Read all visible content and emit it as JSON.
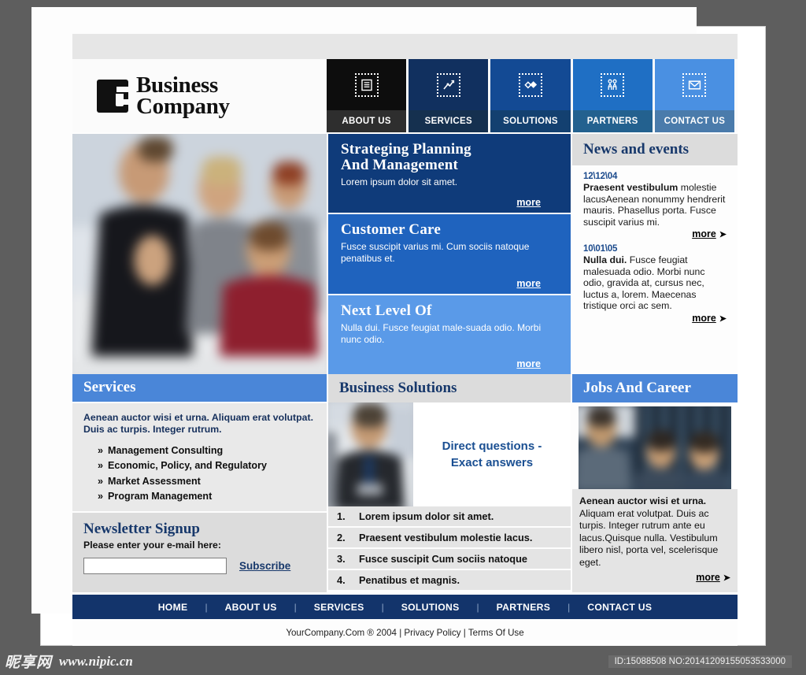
{
  "brand": {
    "logo_icon": "g-monogram-logo",
    "line1": "Business",
    "line2": "Company"
  },
  "nav": {
    "items": [
      {
        "label": "ABOUT US",
        "icon": "document-icon",
        "bg": "#0d0d0d",
        "label_bg": "#2e2e2e"
      },
      {
        "label": "SERVICES",
        "icon": "chart-icon",
        "bg": "#11305f",
        "label_bg": "#15304f"
      },
      {
        "label": "SOLUTIONS",
        "icon": "diamond-icon",
        "bg": "#134a94",
        "label_bg": "#134070"
      },
      {
        "label": "PARTNERS",
        "icon": "people-icon",
        "bg": "#1f6fc4",
        "label_bg": "#23618f"
      },
      {
        "label": "CONTACT US",
        "icon": "envelope-icon",
        "bg": "#4a90e2",
        "label_bg": "#4a7bab"
      }
    ]
  },
  "hero": {
    "alt": "blurred photo of four business people in an office"
  },
  "features": [
    {
      "title_line1": "Strateging Planning",
      "title_line2": "And Management",
      "body": "Lorem ipsum dolor sit amet.",
      "more": "more",
      "bg": "#0f3b7a"
    },
    {
      "title_line1": "Customer Care",
      "title_line2": "",
      "body": "Fusce suscipit varius mi. Cum sociis natoque penatibus et.",
      "more": "more",
      "bg": "#1f63be"
    },
    {
      "title_line1": "Next Level Of",
      "title_line2": "",
      "body": "Nulla dui. Fusce feugiat male-suada odio. Morbi nunc odio.",
      "more": "more",
      "bg": "#5a9ae8"
    }
  ],
  "news": {
    "heading": "News and events",
    "items": [
      {
        "date": "12\\12\\04",
        "lead": "Praesent vestibulum",
        "body": " molestie lacusAenean nonummy hendrerit mauris. Phasellus porta. Fusce suscipit varius mi.",
        "more": "more"
      },
      {
        "date": "10\\01\\05",
        "lead": "Nulla dui.",
        "body": " Fusce feugiat malesuada odio. Morbi nunc odio, gravida at, cursus nec, luctus a, lorem. Maecenas tristique orci ac sem.",
        "more": "more"
      }
    ]
  },
  "services": {
    "heading": "Services",
    "intro": "Aenean auctor wisi et urna. Aliquam erat volutpat. Duis ac turpis. Integer rutrum.",
    "items": [
      "Management Consulting",
      "Economic, Policy, and Regulatory",
      "Market Assessment",
      "Program Management"
    ],
    "bullet": "»"
  },
  "newsletter": {
    "heading": "Newsletter Signup",
    "prompt": "Please enter your e-mail here:",
    "input_value": "",
    "input_placeholder": "",
    "subscribe_label": "Subscribe"
  },
  "solutions": {
    "heading": "Business Solutions",
    "photo_alt": "blurred photo of a businessman",
    "tagline_line1": "Direct questions -",
    "tagline_line2": "Exact answers",
    "items": [
      {
        "num": "1.",
        "text": "Lorem ipsum dolor sit amet."
      },
      {
        "num": "2.",
        "text": "Praesent vestibulum molestie lacus."
      },
      {
        "num": "3.",
        "text": "Fusce suscipit Cum sociis natoque"
      },
      {
        "num": "4.",
        "text": "Penatibus et magnis."
      }
    ]
  },
  "jobs": {
    "heading": "Jobs And Career",
    "photo_alt": "blurred photo of three people at a window",
    "lead": "Aenean auctor wisi et urna.",
    "body": " Aliquam erat volutpat. Duis ac turpis. Integer rutrum ante eu lacus.Quisque nulla. Vestibulum libero nisl, porta vel, scelerisque eget.",
    "more": "more"
  },
  "footer": {
    "links": [
      "HOME",
      "ABOUT US",
      "SERVICES",
      "SOLUTIONS",
      "PARTNERS",
      "CONTACT US"
    ],
    "separator": "|",
    "copyright": "YourCompany.Com ® 2004 | Privacy Policy | Terms Of Use"
  },
  "watermark": {
    "logo_text": "昵享网",
    "url": "www.nipic.cn",
    "id_text": "ID:15088508 NO:20141209155053533000"
  }
}
